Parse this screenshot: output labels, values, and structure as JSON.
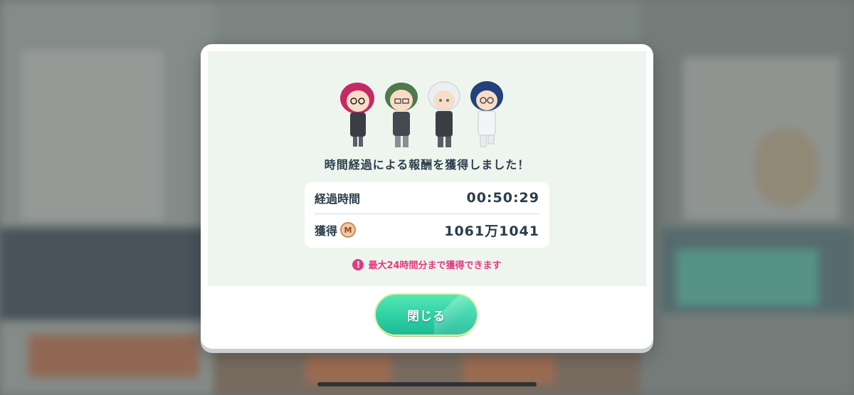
{
  "dialog": {
    "message": "時間経過による報酬を獲得しました！",
    "rows": [
      {
        "label": "経過時間",
        "value": "00:50:29"
      },
      {
        "label": "獲得",
        "value": "1061万1041",
        "currency_icon": "M"
      }
    ],
    "note": "最大24時間分まで獲得できます",
    "close_label": "閉じる"
  },
  "colors": {
    "accent_green": "#2fd0a4",
    "note_pink": "#e23a7d",
    "panel_bg": "#edf5ee",
    "text_dark": "#2a3d4a"
  }
}
